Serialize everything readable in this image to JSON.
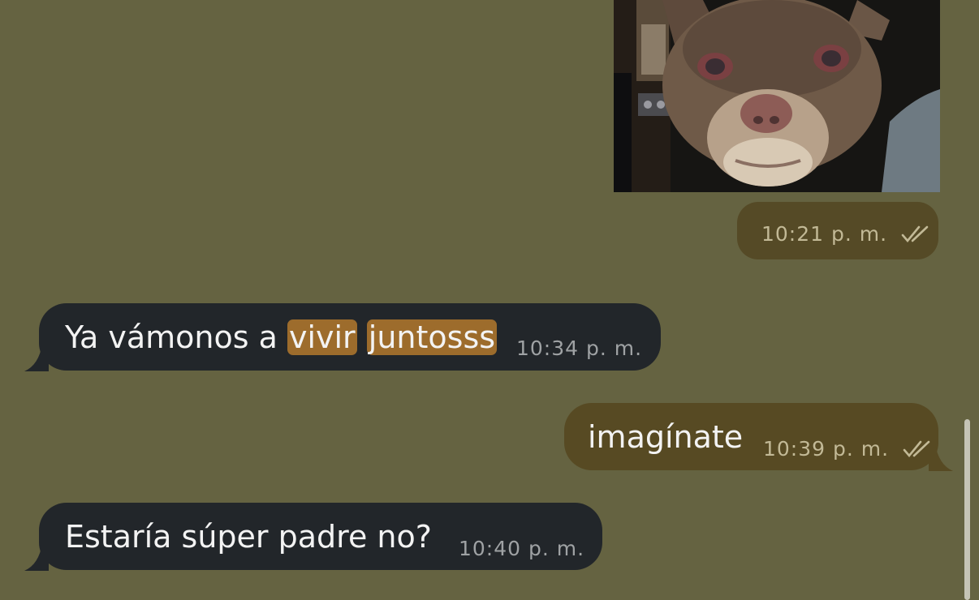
{
  "chat": {
    "photo_message": {
      "time": "10:21",
      "suffix": "p. m.",
      "status_icon": "double-check-icon"
    },
    "messages": [
      {
        "direction": "incoming",
        "text_parts": [
          "Ya vámonos a ",
          "vivir",
          " ",
          "juntosss"
        ],
        "time": "10:34",
        "suffix": "p. m."
      },
      {
        "direction": "outgoing",
        "text": "imagínate",
        "time": "10:39",
        "suffix": "p. m.",
        "status_icon": "double-check-icon"
      },
      {
        "direction": "incoming",
        "text": "Estaría súper padre no?",
        "time": "10:40",
        "suffix": "p. m."
      }
    ]
  },
  "colors": {
    "wallpaper": "#656341",
    "incoming_bubble": "#22262a",
    "outgoing_bubble": "#574a23",
    "highlight": "#9d6c2c"
  }
}
